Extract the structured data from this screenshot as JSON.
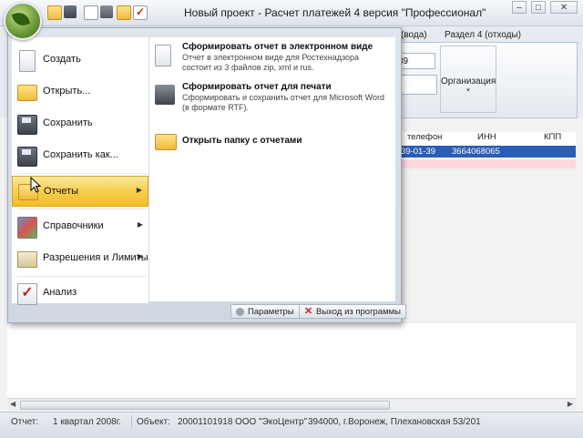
{
  "window": {
    "title": "Новый проект - Расчет платежей 4 версия \"Профессионал\"",
    "controls": [
      "–",
      "□",
      "✕"
    ]
  },
  "ribbon": {
    "tabs": [
      "(вода)",
      "Раздел 4 (отходы)"
    ],
    "field_value": "39",
    "org_button": "Организация"
  },
  "grid": {
    "headers": [
      "телефон",
      "ИНН",
      "КПП"
    ],
    "selected_row": [
      "39-01-39",
      "3664068065",
      ""
    ]
  },
  "app_menu": {
    "left_items": [
      {
        "label": "Создать",
        "icon": "new-document-icon"
      },
      {
        "label": "Открыть...",
        "icon": "open-folder-icon"
      },
      {
        "label": "Сохранить",
        "icon": "save-icon"
      },
      {
        "label": "Сохранить как...",
        "icon": "save-as-icon"
      },
      {
        "label": "Отчеты",
        "icon": "reports-folder-icon",
        "active": true,
        "submenu": true
      },
      {
        "label": "Справочники",
        "icon": "reference-books-icon",
        "submenu": true
      },
      {
        "label": "Разрешения и Лимиты",
        "icon": "permits-icon",
        "submenu": true
      },
      {
        "label": "Анализ",
        "icon": "analysis-icon"
      }
    ],
    "right_items": [
      {
        "title": "Сформировать отчет в электронном виде",
        "desc": "Отчет в электронном виде для Ростехнадзора состоит из 3 файлов zip, xml и rus."
      },
      {
        "title": "Сформировать отчет для печати",
        "desc": "Сформировать и сохранить отчет для Microsoft Word (в формате RTF)."
      },
      {
        "title": "Открыть папку с отчетами",
        "desc": ""
      }
    ],
    "footer": {
      "params_label": "Параметры",
      "exit_label": "Выход из программы"
    }
  },
  "statusbar": {
    "report_label": "Отчет:",
    "report_value": "1 квартал 2008г.",
    "object_label": "Объект:",
    "object_value": "20001101918",
    "org_name": "ООО \"ЭкоЦентр\"",
    "address": "394000, г.Воронеж, Плехановская 53/201"
  }
}
